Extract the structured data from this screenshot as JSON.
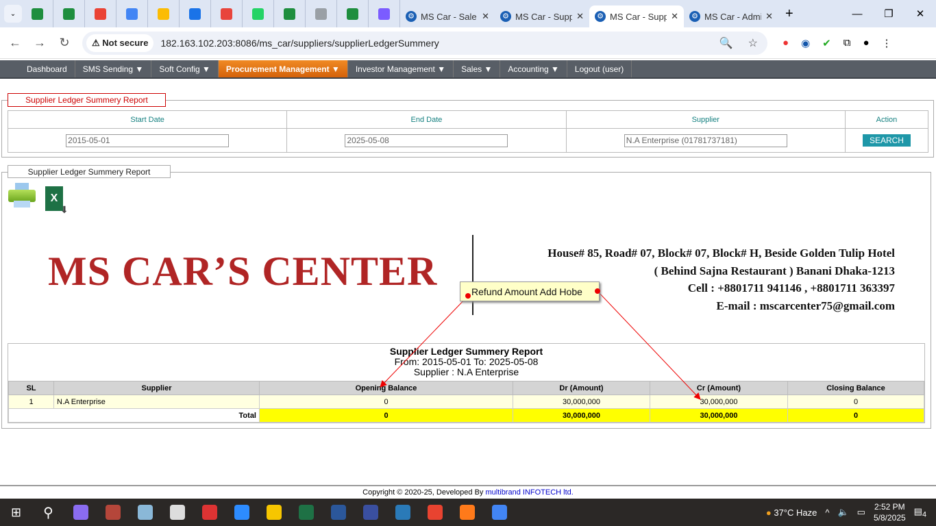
{
  "browser": {
    "tabs": [
      {
        "title": "MS Car - Sale"
      },
      {
        "title": "MS Car - Supplier"
      },
      {
        "title": "MS Car - Supplier",
        "active": true
      },
      {
        "title": "MS Car - Admin"
      }
    ],
    "pinned_colors": [
      "#1e8e3e",
      "#1e8e3e",
      "#ea4335",
      "#4285f4",
      "#fbbc04",
      "#1a73e8",
      "#e8453c",
      "#25d366",
      "#1e8e3e",
      "#9aa0a6",
      "#1e8e3e",
      "#7b5cff"
    ],
    "security": "Not secure",
    "url": "182.163.102.203:8086/ms_car/suppliers/supplierLedgerSummery"
  },
  "nav": [
    "Dashboard",
    "SMS Sending ▼",
    "Soft Config ▼",
    "Procurement Management ▼",
    "Investor Management ▼",
    "Sales ▼",
    "Accounting ▼",
    "Logout (user)"
  ],
  "search": {
    "legend": "Supplier Ledger Summery Report",
    "headers": [
      "Start Date",
      "End Date",
      "Supplier",
      "Action"
    ],
    "start_date": "2015-05-01",
    "end_date": "2025-05-08",
    "supplier": "N.A Enterprise (01781737181)",
    "button": "SEARCH"
  },
  "report": {
    "legend": "Supplier Ledger Summery Report",
    "company": "MS CAR’S CENTER",
    "address": [
      "House# 85, Road# 07, Block# 07, Block# H, Beside Golden Tulip Hotel",
      "( Behind Sajna Restaurant ) Banani Dhaka-1213",
      "Cell : +8801711 941146 , +8801711 363397",
      "E-mail : mscarcenter75@gmail.com"
    ],
    "title": "Supplier Ledger Summery Report",
    "range": "From: 2015-05-01 To: 2025-05-08",
    "supplier_line": "Supplier : N.A Enterprise",
    "columns": [
      "SL",
      "Supplier",
      "Opening Balance",
      "Dr (Amount)",
      "Cr (Amount)",
      "Closing Balance"
    ],
    "rows": [
      [
        "1",
        "N.A Enterprise",
        "0",
        "30,000,000",
        "30,000,000",
        "0"
      ]
    ],
    "total": {
      "label": "Total",
      "values": [
        "0",
        "30,000,000",
        "30,000,000",
        "0"
      ]
    }
  },
  "annotation": "Refund Amount Add Hobe",
  "footer": {
    "text": "Copyright © 2020-25, Developed By ",
    "link": "multibrand INFOTECH ltd."
  },
  "taskbar": {
    "weather": "37°C  Haze",
    "time": "2:52 PM",
    "date": "5/8/2025",
    "notifications": "4"
  }
}
